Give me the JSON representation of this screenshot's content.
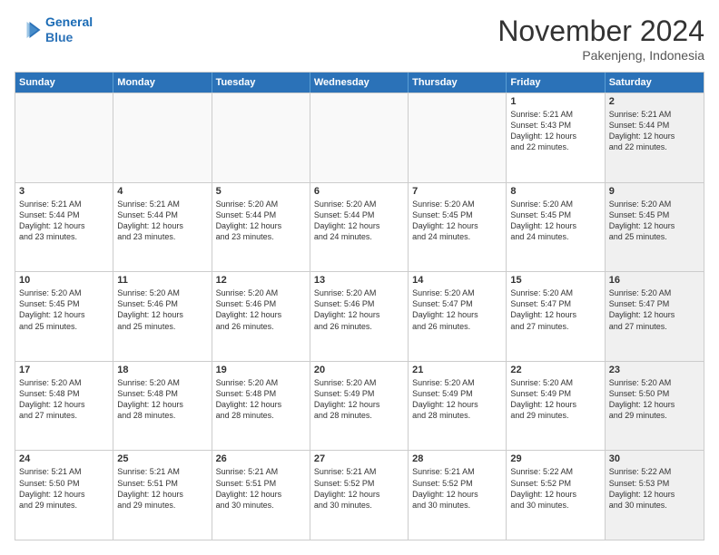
{
  "logo": {
    "line1": "General",
    "line2": "Blue"
  },
  "header": {
    "month": "November 2024",
    "location": "Pakenjeng, Indonesia"
  },
  "weekdays": [
    "Sunday",
    "Monday",
    "Tuesday",
    "Wednesday",
    "Thursday",
    "Friday",
    "Saturday"
  ],
  "rows": [
    [
      {
        "day": "",
        "lines": [],
        "shaded": false,
        "empty": true
      },
      {
        "day": "",
        "lines": [],
        "shaded": false,
        "empty": true
      },
      {
        "day": "",
        "lines": [],
        "shaded": false,
        "empty": true
      },
      {
        "day": "",
        "lines": [],
        "shaded": false,
        "empty": true
      },
      {
        "day": "",
        "lines": [],
        "shaded": false,
        "empty": true
      },
      {
        "day": "1",
        "lines": [
          "Sunrise: 5:21 AM",
          "Sunset: 5:43 PM",
          "Daylight: 12 hours",
          "and 22 minutes."
        ],
        "shaded": false,
        "empty": false
      },
      {
        "day": "2",
        "lines": [
          "Sunrise: 5:21 AM",
          "Sunset: 5:44 PM",
          "Daylight: 12 hours",
          "and 22 minutes."
        ],
        "shaded": true,
        "empty": false
      }
    ],
    [
      {
        "day": "3",
        "lines": [
          "Sunrise: 5:21 AM",
          "Sunset: 5:44 PM",
          "Daylight: 12 hours",
          "and 23 minutes."
        ],
        "shaded": false,
        "empty": false
      },
      {
        "day": "4",
        "lines": [
          "Sunrise: 5:21 AM",
          "Sunset: 5:44 PM",
          "Daylight: 12 hours",
          "and 23 minutes."
        ],
        "shaded": false,
        "empty": false
      },
      {
        "day": "5",
        "lines": [
          "Sunrise: 5:20 AM",
          "Sunset: 5:44 PM",
          "Daylight: 12 hours",
          "and 23 minutes."
        ],
        "shaded": false,
        "empty": false
      },
      {
        "day": "6",
        "lines": [
          "Sunrise: 5:20 AM",
          "Sunset: 5:44 PM",
          "Daylight: 12 hours",
          "and 24 minutes."
        ],
        "shaded": false,
        "empty": false
      },
      {
        "day": "7",
        "lines": [
          "Sunrise: 5:20 AM",
          "Sunset: 5:45 PM",
          "Daylight: 12 hours",
          "and 24 minutes."
        ],
        "shaded": false,
        "empty": false
      },
      {
        "day": "8",
        "lines": [
          "Sunrise: 5:20 AM",
          "Sunset: 5:45 PM",
          "Daylight: 12 hours",
          "and 24 minutes."
        ],
        "shaded": false,
        "empty": false
      },
      {
        "day": "9",
        "lines": [
          "Sunrise: 5:20 AM",
          "Sunset: 5:45 PM",
          "Daylight: 12 hours",
          "and 25 minutes."
        ],
        "shaded": true,
        "empty": false
      }
    ],
    [
      {
        "day": "10",
        "lines": [
          "Sunrise: 5:20 AM",
          "Sunset: 5:45 PM",
          "Daylight: 12 hours",
          "and 25 minutes."
        ],
        "shaded": false,
        "empty": false
      },
      {
        "day": "11",
        "lines": [
          "Sunrise: 5:20 AM",
          "Sunset: 5:46 PM",
          "Daylight: 12 hours",
          "and 25 minutes."
        ],
        "shaded": false,
        "empty": false
      },
      {
        "day": "12",
        "lines": [
          "Sunrise: 5:20 AM",
          "Sunset: 5:46 PM",
          "Daylight: 12 hours",
          "and 26 minutes."
        ],
        "shaded": false,
        "empty": false
      },
      {
        "day": "13",
        "lines": [
          "Sunrise: 5:20 AM",
          "Sunset: 5:46 PM",
          "Daylight: 12 hours",
          "and 26 minutes."
        ],
        "shaded": false,
        "empty": false
      },
      {
        "day": "14",
        "lines": [
          "Sunrise: 5:20 AM",
          "Sunset: 5:47 PM",
          "Daylight: 12 hours",
          "and 26 minutes."
        ],
        "shaded": false,
        "empty": false
      },
      {
        "day": "15",
        "lines": [
          "Sunrise: 5:20 AM",
          "Sunset: 5:47 PM",
          "Daylight: 12 hours",
          "and 27 minutes."
        ],
        "shaded": false,
        "empty": false
      },
      {
        "day": "16",
        "lines": [
          "Sunrise: 5:20 AM",
          "Sunset: 5:47 PM",
          "Daylight: 12 hours",
          "and 27 minutes."
        ],
        "shaded": true,
        "empty": false
      }
    ],
    [
      {
        "day": "17",
        "lines": [
          "Sunrise: 5:20 AM",
          "Sunset: 5:48 PM",
          "Daylight: 12 hours",
          "and 27 minutes."
        ],
        "shaded": false,
        "empty": false
      },
      {
        "day": "18",
        "lines": [
          "Sunrise: 5:20 AM",
          "Sunset: 5:48 PM",
          "Daylight: 12 hours",
          "and 28 minutes."
        ],
        "shaded": false,
        "empty": false
      },
      {
        "day": "19",
        "lines": [
          "Sunrise: 5:20 AM",
          "Sunset: 5:48 PM",
          "Daylight: 12 hours",
          "and 28 minutes."
        ],
        "shaded": false,
        "empty": false
      },
      {
        "day": "20",
        "lines": [
          "Sunrise: 5:20 AM",
          "Sunset: 5:49 PM",
          "Daylight: 12 hours",
          "and 28 minutes."
        ],
        "shaded": false,
        "empty": false
      },
      {
        "day": "21",
        "lines": [
          "Sunrise: 5:20 AM",
          "Sunset: 5:49 PM",
          "Daylight: 12 hours",
          "and 28 minutes."
        ],
        "shaded": false,
        "empty": false
      },
      {
        "day": "22",
        "lines": [
          "Sunrise: 5:20 AM",
          "Sunset: 5:49 PM",
          "Daylight: 12 hours",
          "and 29 minutes."
        ],
        "shaded": false,
        "empty": false
      },
      {
        "day": "23",
        "lines": [
          "Sunrise: 5:20 AM",
          "Sunset: 5:50 PM",
          "Daylight: 12 hours",
          "and 29 minutes."
        ],
        "shaded": true,
        "empty": false
      }
    ],
    [
      {
        "day": "24",
        "lines": [
          "Sunrise: 5:21 AM",
          "Sunset: 5:50 PM",
          "Daylight: 12 hours",
          "and 29 minutes."
        ],
        "shaded": false,
        "empty": false
      },
      {
        "day": "25",
        "lines": [
          "Sunrise: 5:21 AM",
          "Sunset: 5:51 PM",
          "Daylight: 12 hours",
          "and 29 minutes."
        ],
        "shaded": false,
        "empty": false
      },
      {
        "day": "26",
        "lines": [
          "Sunrise: 5:21 AM",
          "Sunset: 5:51 PM",
          "Daylight: 12 hours",
          "and 30 minutes."
        ],
        "shaded": false,
        "empty": false
      },
      {
        "day": "27",
        "lines": [
          "Sunrise: 5:21 AM",
          "Sunset: 5:52 PM",
          "Daylight: 12 hours",
          "and 30 minutes."
        ],
        "shaded": false,
        "empty": false
      },
      {
        "day": "28",
        "lines": [
          "Sunrise: 5:21 AM",
          "Sunset: 5:52 PM",
          "Daylight: 12 hours",
          "and 30 minutes."
        ],
        "shaded": false,
        "empty": false
      },
      {
        "day": "29",
        "lines": [
          "Sunrise: 5:22 AM",
          "Sunset: 5:52 PM",
          "Daylight: 12 hours",
          "and 30 minutes."
        ],
        "shaded": false,
        "empty": false
      },
      {
        "day": "30",
        "lines": [
          "Sunrise: 5:22 AM",
          "Sunset: 5:53 PM",
          "Daylight: 12 hours",
          "and 30 minutes."
        ],
        "shaded": true,
        "empty": false
      }
    ]
  ]
}
